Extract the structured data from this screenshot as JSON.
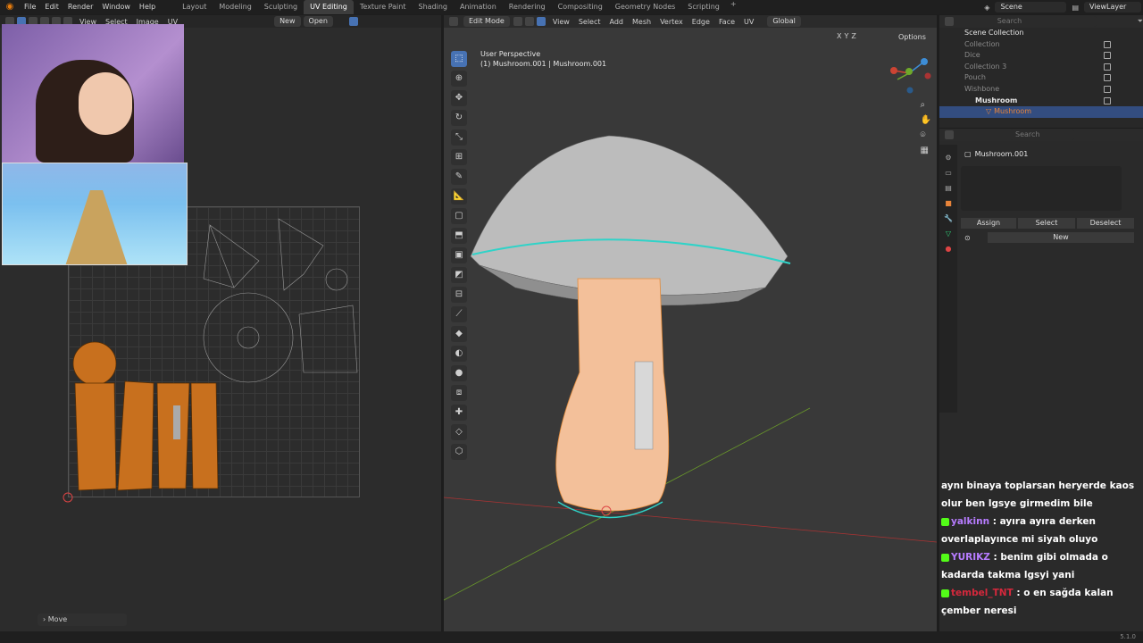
{
  "menus": [
    "File",
    "Edit",
    "Render",
    "Window",
    "Help"
  ],
  "workspaces": [
    "Layout",
    "Modeling",
    "Sculpting",
    "UV Editing",
    "Texture Paint",
    "Shading",
    "Animation",
    "Rendering",
    "Compositing",
    "Geometry Nodes",
    "Scripting"
  ],
  "active_workspace": "UV Editing",
  "scene": "Scene",
  "view_layer": "ViewLayer",
  "uv_header": {
    "menus": [
      "View",
      "Select",
      "Image",
      "UV"
    ],
    "new_label": "New",
    "open_label": "Open"
  },
  "uv_status": "Move",
  "viewport": {
    "mode": "Edit Mode",
    "menus": [
      "View",
      "Select",
      "Add",
      "Mesh",
      "Vertex",
      "Edge",
      "Face",
      "UV"
    ],
    "orientation": "Global",
    "options_label": "Options",
    "view_name": "User Perspective",
    "object_info": "(1) Mushroom.001 | Mushroom.001",
    "axes": [
      "X",
      "Y",
      "Z"
    ]
  },
  "outliner": {
    "search_placeholder": "Search",
    "root": "Scene Collection",
    "items": [
      "Collection",
      "Dice",
      "Collection 3",
      "Pouch",
      "Wishbone"
    ],
    "active_collection": "Mushroom",
    "selected_object": "Mushroom"
  },
  "properties": {
    "search_placeholder": "Search",
    "object_name": "Mushroom.001",
    "assign_label": "Assign",
    "select_label": "Select",
    "deselect_label": "Deselect",
    "new_label": "New"
  },
  "chat": [
    {
      "user": "",
      "text": "aynı binaya toplarsan heryerde kaos olur ben lgsye girmedim bile",
      "color": "#ffffff"
    },
    {
      "user": "yalkinn",
      "text": ": ayıra ayıra derken overlaplayınce mi siyah oluyo",
      "color": "#b77cff"
    },
    {
      "user": "YURIKZ",
      "text": ": benim gibi olmada o kadarda takma lgsyi yani",
      "color": "#b77cff"
    },
    {
      "user": "tembel_TNT",
      "text": ": o en sağda kalan çember neresi",
      "color": "#d6283c"
    }
  ],
  "version": "5.1.0",
  "colors": {
    "accent": "#4772b3",
    "orange": "#e8843a",
    "selection_edge": "#2fd3c8"
  }
}
